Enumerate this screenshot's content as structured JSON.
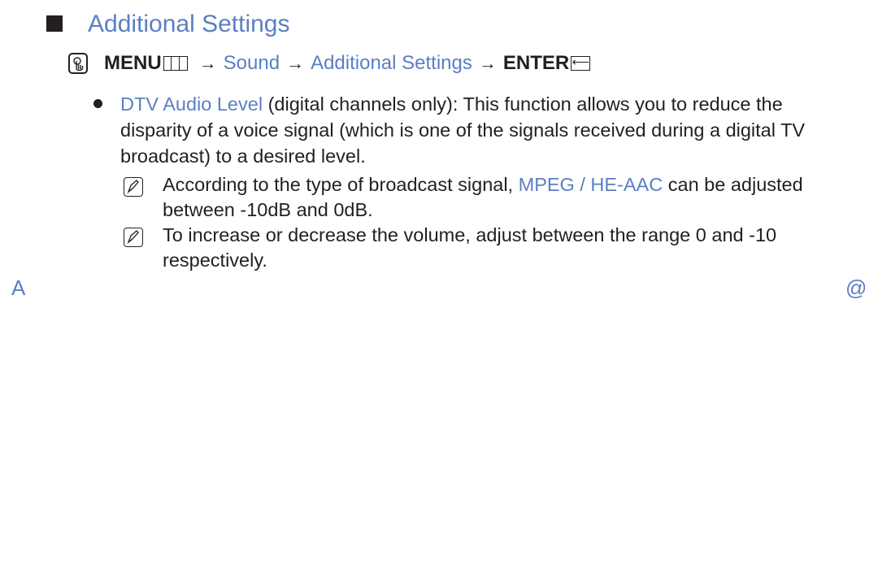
{
  "heading": {
    "title": "Additional Settings"
  },
  "path": {
    "menu_label": "MENU",
    "arrow": "→",
    "steps": [
      "Sound",
      "Additional Settings"
    ],
    "enter_label": "ENTER",
    "enter_icon_glyph": "⟵"
  },
  "bullet": {
    "term": "DTV Audio Level",
    "text": " (digital channels only): This function allows you to reduce the disparity of a voice signal (which is one of the signals received during a digital TV broadcast) to a desired level."
  },
  "notes": [
    {
      "before": "According to the type of broadcast signal, ",
      "highlight": "MPEG / HE-AAC",
      "after": " can be adjusted between -10dB and 0dB."
    },
    {
      "text": "To increase or decrease the volume, adjust between the range 0 and -10 respectively."
    }
  ],
  "footer": {
    "left_glyph": "A",
    "right_glyph": "@"
  },
  "colors": {
    "accent": "#5b7fc2",
    "text": "#231f20"
  }
}
